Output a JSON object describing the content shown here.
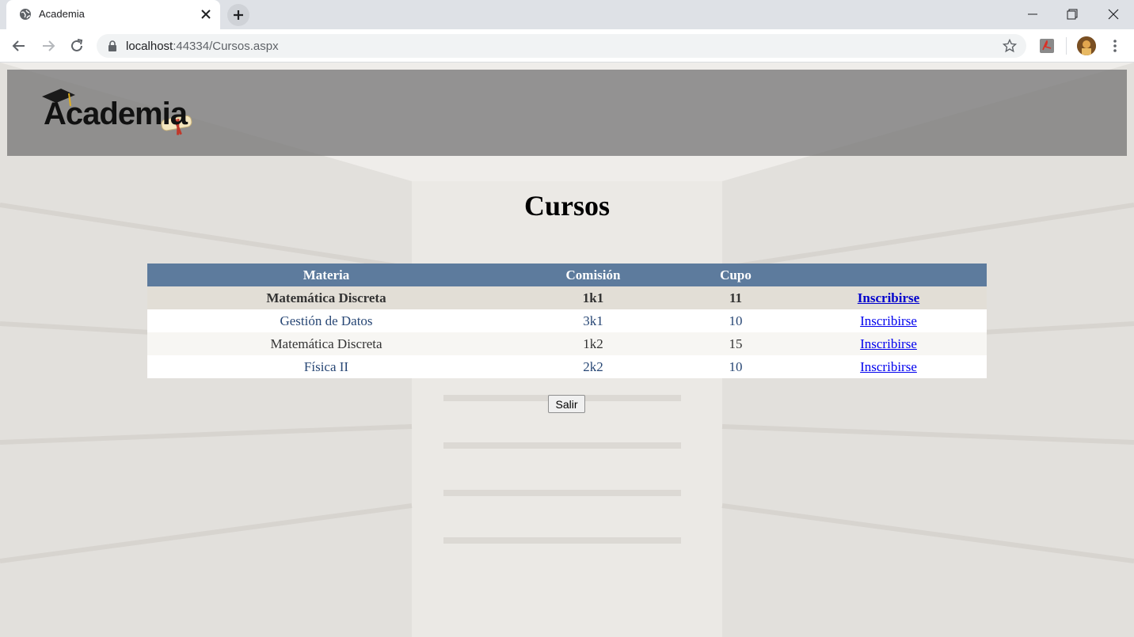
{
  "browser": {
    "tab_title": "Academia",
    "url_host": "localhost",
    "url_rest": ":44334/Cursos.aspx"
  },
  "header": {
    "logo_text": "Academia"
  },
  "page": {
    "title": "Cursos"
  },
  "table": {
    "columns": [
      "Materia",
      "Comisión",
      "Cupo",
      ""
    ],
    "rows": [
      {
        "materia": "Matemática Discreta",
        "comision": "1k1",
        "cupo": "11",
        "action": "Inscribirse",
        "selected": true
      },
      {
        "materia": "Gestión de Datos",
        "comision": "3k1",
        "cupo": "10",
        "action": "Inscribirse"
      },
      {
        "materia": "Matemática Discreta",
        "comision": "1k2",
        "cupo": "15",
        "action": "Inscribirse"
      },
      {
        "materia": "Física II",
        "comision": "2k2",
        "cupo": "10",
        "action": "Inscribirse"
      }
    ]
  },
  "buttons": {
    "salir": "Salir"
  },
  "colors": {
    "header_row": "#5d7b9d",
    "selected_row": "#e2ded6",
    "alt_row": "#f7f6f3",
    "row_text": "#284775"
  }
}
